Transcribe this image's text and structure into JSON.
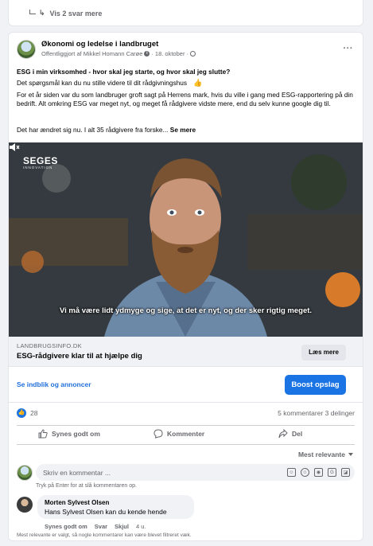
{
  "prev_thread": {
    "show_replies": "Vis 2 svar mere"
  },
  "post": {
    "page_name": "Økonomi og ledelse i landbruget",
    "published_by": "Offentliggjort af Mikkel Homann Carøe",
    "date": "18. oktober",
    "title": "ESG i min virksomhed - hvor skal jeg starte, og hvor skal jeg slutte?",
    "p2": "Det spørgsmål kan du nu stille videre til dit rådgivningshus",
    "p2_emoji": "👍",
    "p3": "For et år siden var du som landbruger groft sagt på Herrens mark, hvis du ville i gang med ESG-rapportering på din bedrift. Alt omkring ESG var meget nyt, og meget få rådgivere vidste mere, end du selv kunne google dig til.",
    "p4": "Det har ændret sig nu. I alt 35 rådgivere fra forske...",
    "see_more": "Se mere"
  },
  "video": {
    "logo": "SEGES",
    "logo_sub": "INNOVATION",
    "caption": "Vi må være lidt ydmyge og sige, at det er nyt, og der sker rigtig meget."
  },
  "link": {
    "domain": "LANDBRUGSINFO.DK",
    "title": "ESG-rådgivere klar til at hjælpe dig",
    "button": "Læs mere"
  },
  "promo": {
    "insights": "Se indblik og annoncer",
    "boost": "Boost opslag"
  },
  "stats": {
    "likes": "28",
    "comments_shares": "5 kommentarer 3 delinger"
  },
  "actions": {
    "like": "Synes godt om",
    "comment": "Kommenter",
    "share": "Del"
  },
  "sort": {
    "label": "Mest relevante"
  },
  "composer": {
    "placeholder": "Skriv en kommentar ...",
    "hint": "Tryk på Enter for at slå kommentaren op."
  },
  "comment": {
    "author": "Morten Sylvest Olsen",
    "text": "Hans Sylvest Olsen kan du kende hende",
    "like": "Synes godt om",
    "reply": "Svar",
    "hide": "Skjul",
    "age": "4 u."
  },
  "footnote": "Mest relevante er valgt, så nogle kommentarer kan være blevet filtreret væk.",
  "colors": {
    "accent": "#1b74e4",
    "link": "#216fdb",
    "muted": "#65676b"
  },
  "icons": {
    "info": "info-icon",
    "globe": "globe-icon",
    "like": "thumbs-up-icon",
    "comment": "speech-bubble-icon",
    "share": "share-arrow-icon",
    "volume": "volume-icon"
  }
}
